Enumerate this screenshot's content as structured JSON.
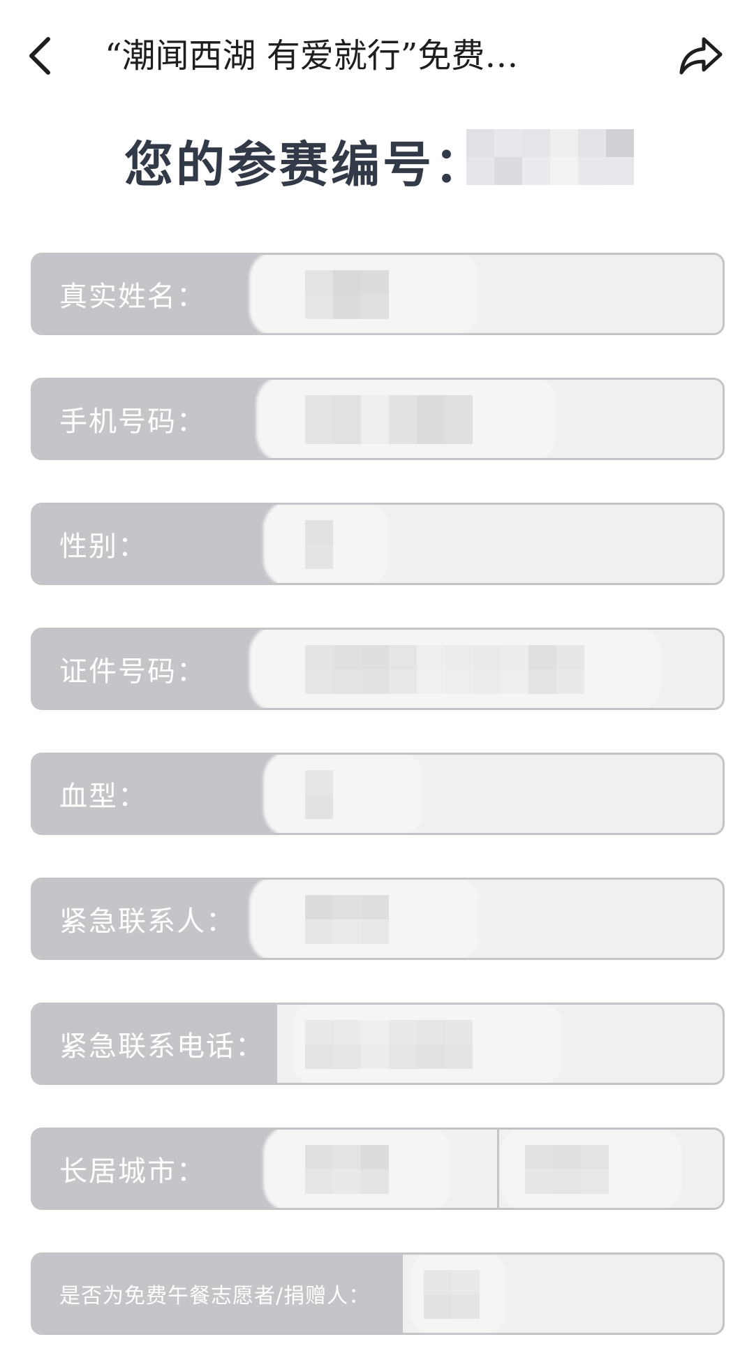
{
  "nav": {
    "title": "“潮闻西湖  有爱就行”免费…",
    "back_icon": "chevron-left-icon",
    "share_icon": "share-icon"
  },
  "registration": {
    "label": "您的参赛编号："
  },
  "form": {
    "fields": [
      {
        "label": "真实姓名："
      },
      {
        "label": "手机号码："
      },
      {
        "label": "性别："
      },
      {
        "label": "证件号码："
      },
      {
        "label": "血型："
      },
      {
        "label": "紧急联系人："
      },
      {
        "label": "紧急联系电话："
      },
      {
        "label": "长居城市："
      },
      {
        "label": "是否为免费午餐志愿者/捐赠人："
      }
    ]
  },
  "colors": {
    "label_bg": "#c4c5c9",
    "value_bg": "#f0f0f2",
    "border": "#c3c4c8",
    "heading": "#333a47"
  }
}
